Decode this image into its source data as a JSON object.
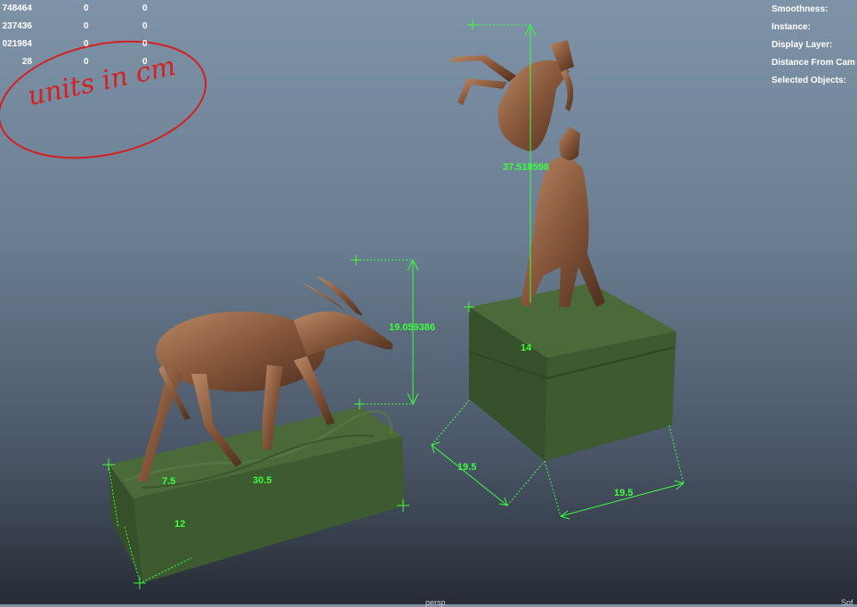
{
  "heads_up": {
    "poly_count_rows": [
      [
        "748464",
        "0",
        "0"
      ],
      [
        "237436",
        "0",
        "0"
      ],
      [
        "021984",
        "0",
        "0"
      ],
      [
        "28",
        "0",
        "0"
      ]
    ],
    "object_info_labels": [
      "Smoothness:",
      "Instance:",
      "Display Layer:",
      "Distance From Cam",
      "Selected Objects:"
    ]
  },
  "annotation": {
    "handwritten_note": "units in cm",
    "ink_color": "#d42020"
  },
  "measurements": {
    "statue_height": "37.518598",
    "antelope_height": "19.059386",
    "left_base_depth": "7.5",
    "left_base_length": "30.5",
    "left_base_height": "12",
    "right_base_height": "14",
    "right_base_depth": "19.5",
    "right_base_width": "19.5"
  },
  "viewport": {
    "camera_label": "persp",
    "corner_text": "Sof"
  },
  "colors": {
    "measure_green": "#3cff3c",
    "base_green": "#3f5a30",
    "bronze": "#8a5a3c"
  }
}
